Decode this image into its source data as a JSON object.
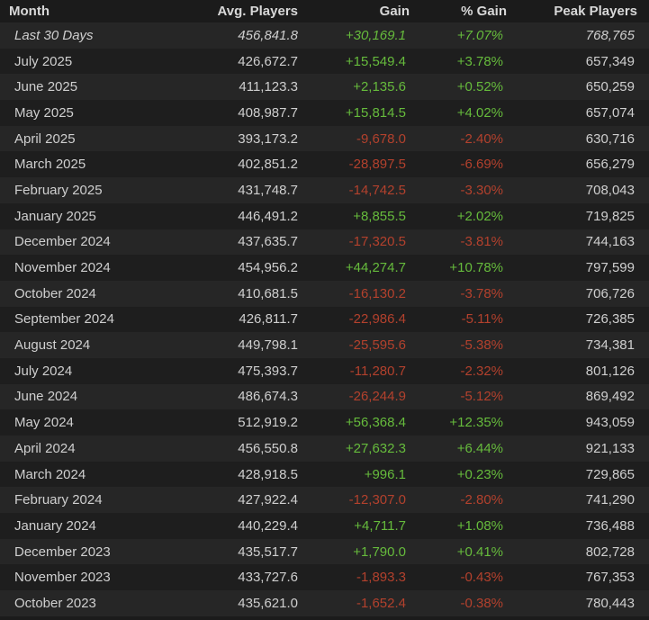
{
  "columns": {
    "month": "Month",
    "avg": "Avg. Players",
    "gain": "Gain",
    "pct": "% Gain",
    "peak": "Peak Players"
  },
  "colors": {
    "positive": "#66bb3c",
    "negative": "#b3412d",
    "row_odd": "#262626",
    "row_even": "#1e1e1e"
  },
  "rows": [
    {
      "month": "Last 30 Days",
      "avg": "456,841.8",
      "gain": "+30,169.1",
      "pct": "+7.07%",
      "peak": "768,765",
      "trend": "positive",
      "italic": true
    },
    {
      "month": "July 2025",
      "avg": "426,672.7",
      "gain": "+15,549.4",
      "pct": "+3.78%",
      "peak": "657,349",
      "trend": "positive"
    },
    {
      "month": "June 2025",
      "avg": "411,123.3",
      "gain": "+2,135.6",
      "pct": "+0.52%",
      "peak": "650,259",
      "trend": "positive"
    },
    {
      "month": "May 2025",
      "avg": "408,987.7",
      "gain": "+15,814.5",
      "pct": "+4.02%",
      "peak": "657,074",
      "trend": "positive"
    },
    {
      "month": "April 2025",
      "avg": "393,173.2",
      "gain": "-9,678.0",
      "pct": "-2.40%",
      "peak": "630,716",
      "trend": "negative"
    },
    {
      "month": "March 2025",
      "avg": "402,851.2",
      "gain": "-28,897.5",
      "pct": "-6.69%",
      "peak": "656,279",
      "trend": "negative"
    },
    {
      "month": "February 2025",
      "avg": "431,748.7",
      "gain": "-14,742.5",
      "pct": "-3.30%",
      "peak": "708,043",
      "trend": "negative"
    },
    {
      "month": "January 2025",
      "avg": "446,491.2",
      "gain": "+8,855.5",
      "pct": "+2.02%",
      "peak": "719,825",
      "trend": "positive"
    },
    {
      "month": "December 2024",
      "avg": "437,635.7",
      "gain": "-17,320.5",
      "pct": "-3.81%",
      "peak": "744,163",
      "trend": "negative"
    },
    {
      "month": "November 2024",
      "avg": "454,956.2",
      "gain": "+44,274.7",
      "pct": "+10.78%",
      "peak": "797,599",
      "trend": "positive"
    },
    {
      "month": "October 2024",
      "avg": "410,681.5",
      "gain": "-16,130.2",
      "pct": "-3.78%",
      "peak": "706,726",
      "trend": "negative"
    },
    {
      "month": "September 2024",
      "avg": "426,811.7",
      "gain": "-22,986.4",
      "pct": "-5.11%",
      "peak": "726,385",
      "trend": "negative"
    },
    {
      "month": "August 2024",
      "avg": "449,798.1",
      "gain": "-25,595.6",
      "pct": "-5.38%",
      "peak": "734,381",
      "trend": "negative"
    },
    {
      "month": "July 2024",
      "avg": "475,393.7",
      "gain": "-11,280.7",
      "pct": "-2.32%",
      "peak": "801,126",
      "trend": "negative"
    },
    {
      "month": "June 2024",
      "avg": "486,674.3",
      "gain": "-26,244.9",
      "pct": "-5.12%",
      "peak": "869,492",
      "trend": "negative"
    },
    {
      "month": "May 2024",
      "avg": "512,919.2",
      "gain": "+56,368.4",
      "pct": "+12.35%",
      "peak": "943,059",
      "trend": "positive"
    },
    {
      "month": "April 2024",
      "avg": "456,550.8",
      "gain": "+27,632.3",
      "pct": "+6.44%",
      "peak": "921,133",
      "trend": "positive"
    },
    {
      "month": "March 2024",
      "avg": "428,918.5",
      "gain": "+996.1",
      "pct": "+0.23%",
      "peak": "729,865",
      "trend": "positive"
    },
    {
      "month": "February 2024",
      "avg": "427,922.4",
      "gain": "-12,307.0",
      "pct": "-2.80%",
      "peak": "741,290",
      "trend": "negative"
    },
    {
      "month": "January 2024",
      "avg": "440,229.4",
      "gain": "+4,711.7",
      "pct": "+1.08%",
      "peak": "736,488",
      "trend": "positive"
    },
    {
      "month": "December 2023",
      "avg": "435,517.7",
      "gain": "+1,790.0",
      "pct": "+0.41%",
      "peak": "802,728",
      "trend": "positive"
    },
    {
      "month": "November 2023",
      "avg": "433,727.6",
      "gain": "-1,893.3",
      "pct": "-0.43%",
      "peak": "767,353",
      "trend": "negative"
    },
    {
      "month": "October 2023",
      "avg": "435,621.0",
      "gain": "-1,652.4",
      "pct": "-0.38%",
      "peak": "780,443",
      "trend": "negative"
    }
  ]
}
